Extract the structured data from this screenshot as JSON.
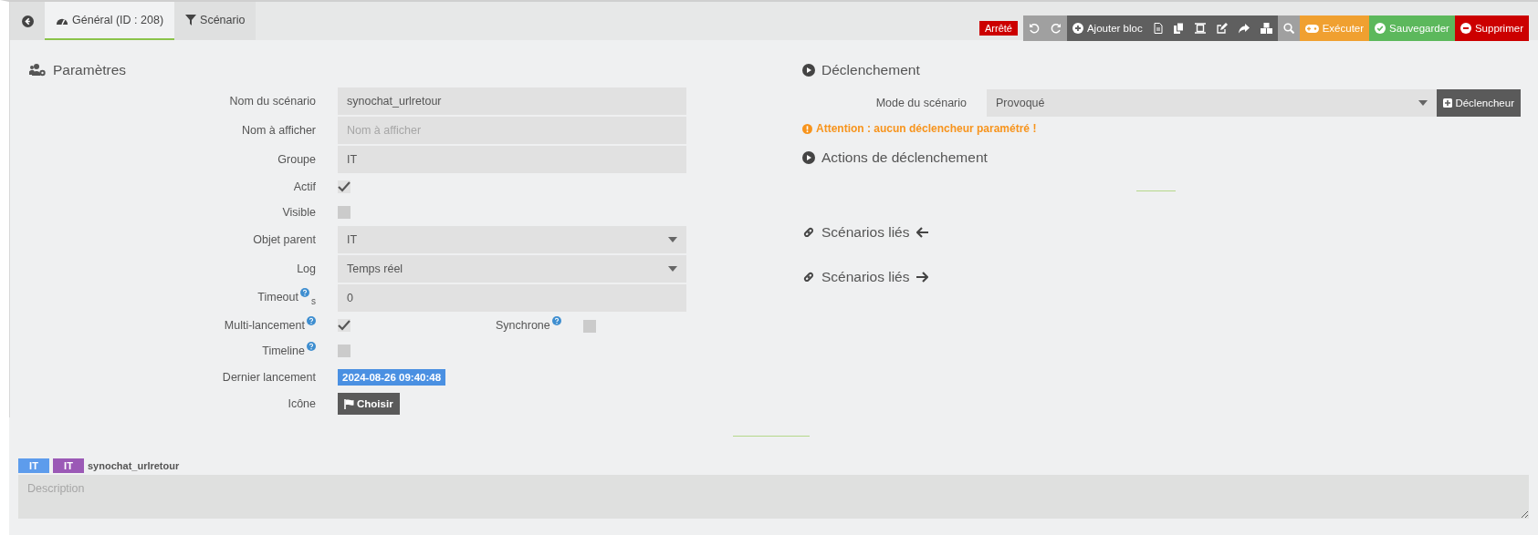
{
  "nav": {
    "tabs": [
      {
        "label": "Général (ID : 208)",
        "kind": "general",
        "selected": true
      },
      {
        "label": "Scénario",
        "kind": "scenario",
        "selected": false
      }
    ]
  },
  "status_badge": "Arrêté",
  "toolbar": [
    {
      "kind": "undo"
    },
    {
      "kind": "redo"
    },
    {
      "kind": "add-block",
      "label": "Ajouter bloc"
    },
    {
      "kind": "log"
    },
    {
      "kind": "copy"
    },
    {
      "kind": "graph"
    },
    {
      "kind": "edit"
    },
    {
      "kind": "export"
    },
    {
      "kind": "template"
    },
    {
      "kind": "search"
    },
    {
      "kind": "run",
      "label": "Exécuter"
    },
    {
      "kind": "save",
      "label": "Sauvegarder"
    },
    {
      "kind": "remove",
      "label": "Supprimer"
    }
  ],
  "params": {
    "title": "Paramètres",
    "fields": [
      {
        "kind": "text",
        "label": "Nom du scénario",
        "value": "synochat_urlretour"
      },
      {
        "kind": "text",
        "label": "Nom à afficher",
        "placeholder": "Nom à afficher"
      },
      {
        "kind": "text",
        "label": "Groupe",
        "value": "IT"
      },
      {
        "kind": "checkbox",
        "label": "Actif",
        "checked": true
      },
      {
        "kind": "checkbox",
        "label": "Visible",
        "checked": false
      },
      {
        "kind": "select",
        "label": "Objet parent",
        "value": "IT"
      },
      {
        "kind": "select",
        "label": "Log",
        "value": "Temps réel"
      },
      {
        "kind": "text",
        "label": "Timeout",
        "help": true,
        "unit": "s",
        "value": "0"
      },
      {
        "kind": "checkbox",
        "label": "Multi-lancement",
        "help": true,
        "checked": true,
        "extra": {
          "label": "Synchrone",
          "help": true,
          "checked": false
        }
      },
      {
        "kind": "checkbox",
        "label": "Timeline",
        "help": true,
        "checked": false
      },
      {
        "kind": "date",
        "label": "Dernier lancement",
        "value": "2024-08-26 09:40:48"
      },
      {
        "kind": "button",
        "label": "Icône",
        "button": "Choisir"
      }
    ]
  },
  "trigger": {
    "title": "Déclenchement",
    "mode_label": "Mode du scénario",
    "mode_value": "Provoqué",
    "add_button": "Déclencheur",
    "warning": "Attention : aucun déclencheur paramétré !"
  },
  "actions_title": "Actions de déclenchement",
  "linked": [
    {
      "label": "Scénarios liés",
      "kind": "incoming"
    },
    {
      "label": "Scénarios liés",
      "kind": "outgoing"
    }
  ],
  "footer": {
    "tags": [
      {
        "label": "IT",
        "color": "#5d9cec"
      },
      {
        "label": "IT",
        "color": "#9b59b6"
      }
    ],
    "name": "synochat_urlretour",
    "description_placeholder": "Description"
  }
}
